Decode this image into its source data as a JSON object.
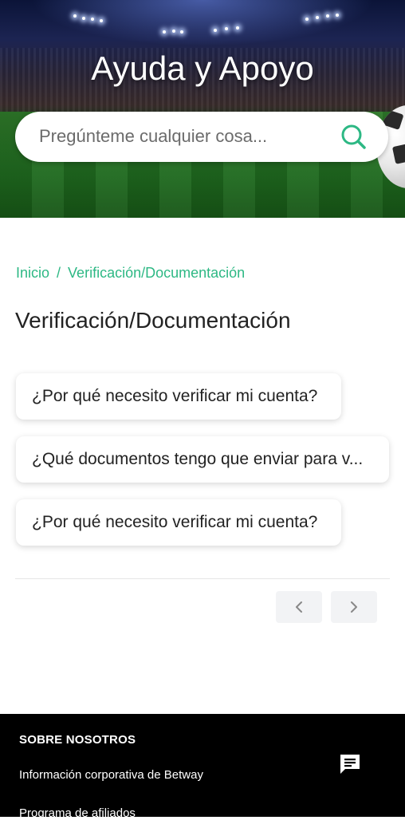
{
  "hero": {
    "title": "Ayuda y Apoyo"
  },
  "search": {
    "placeholder": "Pregúnteme cualquier cosa...",
    "value": "",
    "icon": "search-icon"
  },
  "breadcrumb": {
    "home": "Inicio",
    "separator": "/",
    "current": "Verificación/Documentación"
  },
  "page": {
    "title": "Verificación/Documentación"
  },
  "articles": [
    "¿Por qué necesito verificar mi cuenta?",
    "¿Qué documentos tengo que enviar para v...",
    "¿Por qué necesito verificar mi cuenta?"
  ],
  "pagination": {
    "prev_icon": "chevron-left-icon",
    "next_icon": "chevron-right-icon"
  },
  "footer": {
    "heading": "SOBRE NOSOTROS",
    "links": [
      "Información corporativa de Betway",
      "Programa de afiliados"
    ],
    "chat_icon": "chat-icon"
  },
  "colors": {
    "accent": "#2db884",
    "footer_bg": "#000000",
    "pager_bg": "#f2f3f5"
  }
}
